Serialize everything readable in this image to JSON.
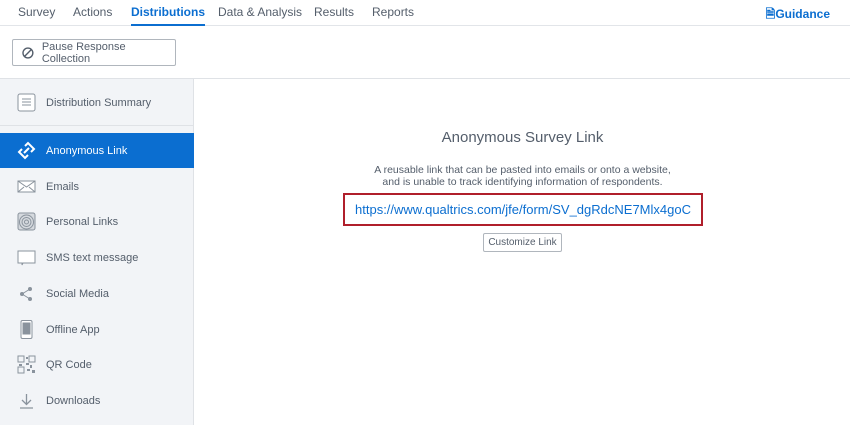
{
  "nav": {
    "tabs": [
      "Survey",
      "Actions",
      "Distributions",
      "Data & Analysis",
      "Results",
      "Reports"
    ],
    "active": "Distributions",
    "guidance": "Guidance"
  },
  "toolbar": {
    "pause_label": "Pause Response Collection"
  },
  "sidebar": {
    "items": [
      {
        "label": "Distribution Summary",
        "icon": "list-icon"
      },
      {
        "label": "Anonymous Link",
        "icon": "link-icon"
      },
      {
        "label": "Emails",
        "icon": "envelope-icon"
      },
      {
        "label": "Personal Links",
        "icon": "fingerprint-icon"
      },
      {
        "label": "SMS text message",
        "icon": "chat-bubble-icon"
      },
      {
        "label": "Social Media",
        "icon": "share-icon"
      },
      {
        "label": "Offline App",
        "icon": "tablet-icon"
      },
      {
        "label": "QR Code",
        "icon": "qr-code-icon"
      },
      {
        "label": "Downloads",
        "icon": "download-icon"
      }
    ]
  },
  "main": {
    "title": "Anonymous Survey Link",
    "description_line1": "A reusable link that can be pasted into emails or onto a website,",
    "description_line2": "and is unable to track identifying information of respondents.",
    "link": "https://www.qualtrics.com/jfe/form/SV_dgRdcNE7Mlx4goC",
    "customize_label": "Customize Link"
  },
  "colors": {
    "accent": "#0b6ed0",
    "highlight_border": "#b01f2b",
    "sidebar_bg": "#f2f4f7"
  }
}
